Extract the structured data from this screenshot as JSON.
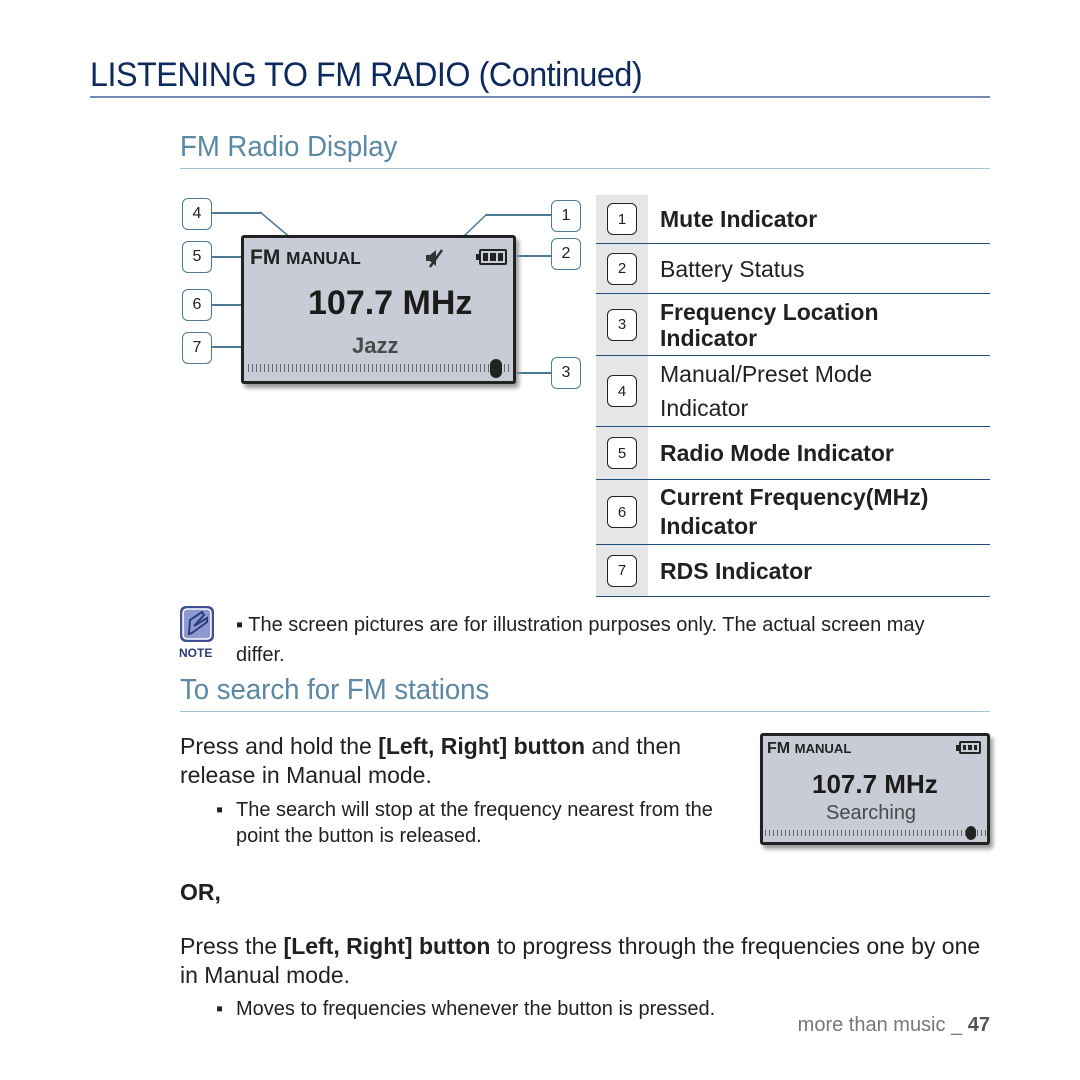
{
  "page": {
    "title": "LISTENING TO FM RADIO (Continued)",
    "footer_text": "more than music _",
    "page_number": "47"
  },
  "fm_display_section": {
    "heading": "FM Radio Display",
    "lcd": {
      "band": "FM",
      "mode": "MANUAL",
      "frequency": "107.7 MHz",
      "rds": "Jazz",
      "icons": [
        "mute-icon",
        "battery-icon"
      ],
      "frequency_position": 0.93
    },
    "callouts": [
      "1",
      "2",
      "3",
      "4",
      "5",
      "6",
      "7"
    ],
    "legend": [
      {
        "num": "1",
        "label": "Mute Indicator",
        "bold": true
      },
      {
        "num": "2",
        "label": "Battery Status",
        "bold": false
      },
      {
        "num": "3",
        "label": "Frequency Location Indicator",
        "bold": true
      },
      {
        "num": "4",
        "label": "Manual/Preset Mode Indicator",
        "bold": false
      },
      {
        "num": "5",
        "label": "Radio Mode Indicator",
        "bold": true
      },
      {
        "num": "6",
        "label": "Current Frequency(MHz) Indicator",
        "bold": true
      },
      {
        "num": "7",
        "label": "RDS Indicator",
        "bold": true
      }
    ],
    "legend_lines": {
      "3": [
        "Frequency Location",
        "Indicator"
      ],
      "4": [
        "Manual/Preset Mode",
        "Indicator"
      ],
      "6": [
        "Current Frequency(MHz)",
        "Indicator"
      ]
    }
  },
  "note": {
    "label": "NOTE",
    "text": "▪ The screen pictures are for illustration purposes only. The actual screen may differ."
  },
  "search_section": {
    "heading": "To search for FM stations",
    "step1_pre": "Press and hold the ",
    "step1_bold": "[Left, Right] button",
    "step1_post": " and then release in Manual mode.",
    "step1_bullet": "The search will stop at the frequency nearest from the point the button is released.",
    "or_label": "OR,",
    "step2_pre": "Press the ",
    "step2_bold": "[Left, Right] button",
    "step2_post": " to progress through the frequencies one by one in Manual mode.",
    "step2_bullet": "Moves to frequencies whenever the button is pressed.",
    "lcd": {
      "band": "FM",
      "mode": "MANUAL",
      "frequency": "107.7 MHz",
      "status": "Searching",
      "icons": [
        "battery-icon"
      ],
      "frequency_position": 0.93
    }
  }
}
